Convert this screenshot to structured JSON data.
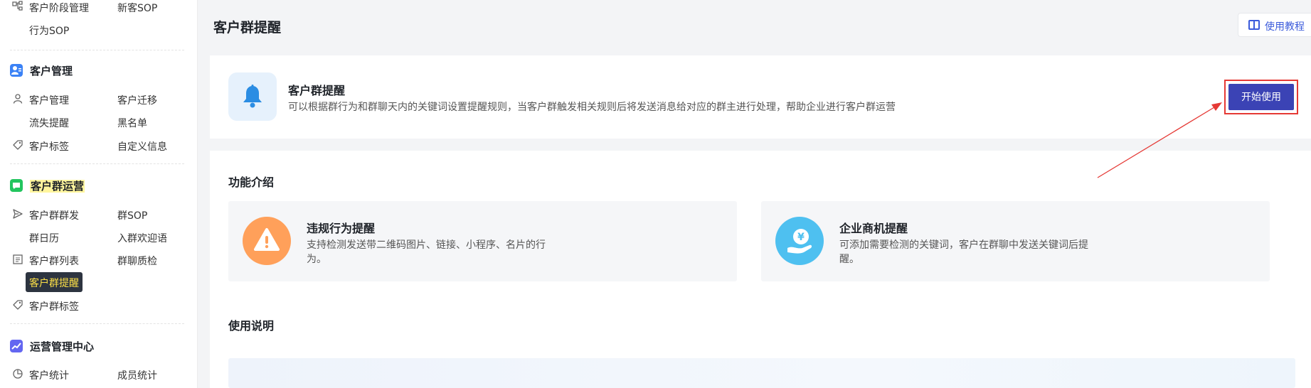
{
  "sidebar": {
    "rows": [
      {
        "icon": "flow-icon",
        "c1": "客户阶段管理",
        "c2": "新客SOP"
      },
      {
        "icon": "",
        "c1": "行为SOP",
        "c2": ""
      },
      {
        "icon": "user-icon",
        "c1": "客户管理",
        "c2": "客户迁移"
      },
      {
        "icon": "",
        "c1": "流失提醒",
        "c2": "黑名单"
      },
      {
        "icon": "tag-icon",
        "c1": "客户标签",
        "c2": "自定义信息"
      },
      {
        "icon": "send-icon",
        "c1": "客户群群发",
        "c2": "群SOP"
      },
      {
        "icon": "",
        "c1": "群日历",
        "c2": "入群欢迎语"
      },
      {
        "icon": "list-icon",
        "c1": "客户群列表",
        "c2": "群聊质检"
      },
      {
        "icon": "tag-icon",
        "c1": "客户群标签",
        "c2": ""
      },
      {
        "icon": "pie-chart-icon",
        "c1": "客户统计",
        "c2": "成员统计"
      }
    ],
    "sections": {
      "customer_mgmt": "客户管理",
      "group_ops": "客户群运营",
      "ops_center": "运营管理中心"
    },
    "active_item": "客户群提醒"
  },
  "header": {
    "title": "客户群提醒",
    "tutorial_label": "使用教程"
  },
  "intro": {
    "title": "客户群提醒",
    "description": "可以根据群行为和群聊天内的关键词设置提醒规则，当客户群触发相关规则后将发送消息给对应的群主进行处理，帮助企业进行客户群运营",
    "start_button": "开始使用"
  },
  "features": {
    "section_title": "功能介绍",
    "items": [
      {
        "title": "违规行为提醒",
        "description": "支持检测发送带二维码图片、链接、小程序、名片的行为。",
        "icon": "warning-icon",
        "color": "#ffa05a"
      },
      {
        "title": "企业商机提醒",
        "description": "可添加需要检测的关键词，客户在群聊中发送关键词后提醒。",
        "icon": "yen-hand-icon",
        "color": "#4ec0f0"
      }
    ]
  },
  "usage": {
    "section_title": "使用说明"
  },
  "colors": {
    "primary": "#3b43b5",
    "annotation": "#e53935",
    "sidebar_highlight": "#fff59d"
  }
}
